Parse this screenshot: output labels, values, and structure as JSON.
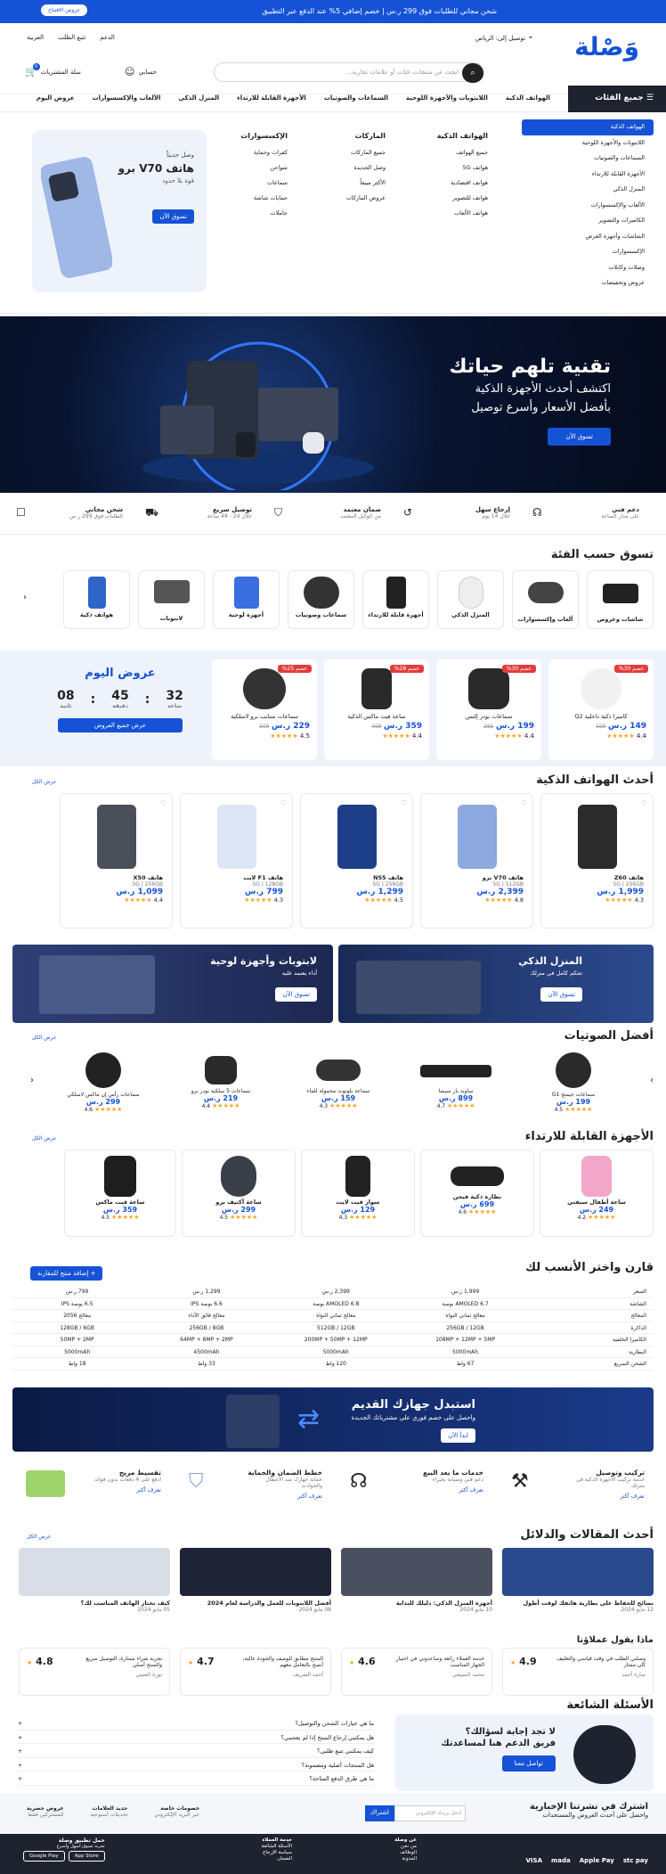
{
  "topbar": {
    "promo": "شحن مجاني للطلبات فوق 299 ر.س  |  خصم إضافي 5% عند الدفع عبر التطبيق",
    "app_button": "عروض الافتتاح"
  },
  "header": {
    "logo": "وَصْلة",
    "deliver": "توصيل إلى: الرياض",
    "links": [
      "الدعم",
      "تتبع الطلب",
      "العربية"
    ],
    "search_placeholder": "ابحث عن منتجات، فئات أو علامات تجارية...",
    "account": "حسابي",
    "cart": "سلة المشتريات",
    "cart_count": "0"
  },
  "nav": {
    "all_categories": "جميع الفئات",
    "links": [
      "الهواتف الذكية",
      "اللابتوبات والأجهزة اللوحية",
      "السماعات والصوتيات",
      "الأجهزة القابلة للارتداء",
      "المنزل الذكي",
      "الألعاب والإكسسوارات",
      "عروض اليوم"
    ]
  },
  "mega": {
    "categories": [
      "الهواتف الذكية",
      "اللابتوبات والأجهزة اللوحية",
      "السماعات والصوتيات",
      "الأجهزة القابلة للارتداء",
      "المنزل الذكي",
      "الألعاب والإكسسوارات",
      "الكاميرات والتصوير",
      "الشاشات وأجهزة العرض",
      "الإكسسوارات",
      "وصلات وكابلات",
      "عروض وتخفيضات"
    ],
    "columns": [
      {
        "title": "الهواتف الذكية",
        "items": [
          "جميع الهواتف",
          "هواتف 5G",
          "هواتف اقتصادية",
          "هواتف للتصوير",
          "هواتف الألعاب"
        ]
      },
      {
        "title": "الماركات",
        "items": [
          "جميع الماركات",
          "وصل الجديدة",
          "الأكثر مبيعاً",
          "عروض الماركات"
        ]
      },
      {
        "title": "الإكسسوارات",
        "items": [
          "كفرات وحماية",
          "شواحن",
          "سماعات",
          "حمايات شاشة",
          "حاملات"
        ]
      }
    ],
    "promo": {
      "kicker": "وصل حديثاً",
      "title": "هاتف V70 برو",
      "subtitle": "قوة بلا حدود",
      "button": "تسوق الآن"
    }
  },
  "hero": {
    "title": "تقنية تلهم حياتك",
    "line1": "اكتشف أحدث الأجهزة الذكية",
    "line2": "بأفضل الأسعار وأسرع توصيل",
    "button": "تسوق الآن"
  },
  "features": [
    {
      "title": "دعم فني",
      "sub": "على مدار الساعة",
      "icon": "headset-icon"
    },
    {
      "title": "إرجاع سهل",
      "sub": "خلال 14 يوم",
      "icon": "return-icon"
    },
    {
      "title": "ضمان معتمد",
      "sub": "من الوكيل المعتمد",
      "icon": "shield-icon"
    },
    {
      "title": "توصيل سريع",
      "sub": "خلال 24 - 48 ساعة",
      "icon": "truck-icon"
    },
    {
      "title": "شحن مجاني",
      "sub": "للطلبات فوق 299 ر.س",
      "icon": "box-icon"
    }
  ],
  "categories": {
    "title": "تسوق حسب الفئة",
    "items": [
      "شاشات وعروض",
      "ألعاب وإكسسوارات",
      "المنزل الذكي",
      "أجهزة قابلة للارتداء",
      "سماعات وصوتيات",
      "أجهزة لوحية",
      "لابتوبات",
      "هواتف ذكية"
    ]
  },
  "deals": {
    "title": "عروض اليوم",
    "hours": "32",
    "minutes": "45",
    "seconds": "08",
    "unit_h": "ساعة",
    "unit_m": "دقيقة",
    "unit_s": "ثانية",
    "button": "عرض جميع العروض",
    "items": [
      {
        "badge": "خصم 30%",
        "name": "كاميرا ذكية داخلية Q2",
        "price": "149 ر.س",
        "old": "199",
        "rating": "4.4"
      },
      {
        "badge": "خصم 30%",
        "name": "سماعات بودز إلتس",
        "price": "199 ر.س",
        "old": "285",
        "rating": "4.4"
      },
      {
        "badge": "خصم 28%",
        "name": "ساعة فيت ماكس الذكية",
        "price": "359 ر.س",
        "old": "499",
        "rating": "4.4"
      },
      {
        "badge": "خصم 25%",
        "name": "سماعات ستايب برو لاسلكية",
        "price": "229 ر.س",
        "old": "309",
        "rating": "4.5"
      }
    ]
  },
  "phones": {
    "title": "أحدث الهواتف الذكية",
    "view_all": "عرض الكل",
    "items": [
      {
        "name": "هاتف Z60",
        "spec": "5G | 256GB",
        "price": "1,999 ر.س",
        "rating": "4.3"
      },
      {
        "name": "هاتف V70 برو",
        "spec": "5G | 512GB",
        "price": "2,399 ر.س",
        "rating": "4.8"
      },
      {
        "name": "هاتف N55",
        "spec": "5G | 256GB",
        "price": "1,299 ر.س",
        "rating": "4.5"
      },
      {
        "name": "هاتف F1 لايت",
        "spec": "5G | 128GB",
        "price": "799 ر.س",
        "rating": "4.3"
      },
      {
        "name": "هاتف X50",
        "spec": "5G | 256GB",
        "price": "1,099 ر.س",
        "rating": "4.4"
      }
    ]
  },
  "banners": [
    {
      "title": "المنزل الذكي",
      "sub": "تحكم كامل في منزلك",
      "button": "تسوق الآن"
    },
    {
      "title": "لابتوبات وأجهزة لوحية",
      "sub": "أداء يعتمد عليه",
      "button": "تسوق الآن"
    }
  ],
  "audio": {
    "title": "أفضل الصوتيات",
    "view_all": "عرض الكل",
    "items": [
      {
        "name": "سماعات جيمنج G1",
        "price": "199 ر.س",
        "rating": "4.5"
      },
      {
        "name": "ساوند بار سينما",
        "price": "899 ر.س",
        "rating": "4.7"
      },
      {
        "name": "سماعة بلوتوث محمولة للماء",
        "price": "159 ر.س",
        "rating": "4.3"
      },
      {
        "name": "سماعات 5 سلكية بودز برو",
        "price": "219 ر.س",
        "rating": "4.4"
      },
      {
        "name": "سماعات رأس إن ماكس لاسلكي",
        "price": "299 ر.س",
        "rating": "4.6"
      }
    ]
  },
  "wearables": {
    "title": "الأجهزة القابلة للارتداء",
    "view_all": "عرض الكل",
    "items": [
      {
        "name": "ساعة أطفال سيفتي",
        "price": "249 ر.س",
        "rating": "4.2"
      },
      {
        "name": "نظارة ذكية فيجن",
        "price": "699 ر.س",
        "rating": "4.6"
      },
      {
        "name": "سوار فيت لايت",
        "price": "129 ر.س",
        "rating": "4.3"
      },
      {
        "name": "ساعة أكتيف برو",
        "price": "299 ر.س",
        "rating": "4.5"
      },
      {
        "name": "ساعة فيت ماكس",
        "price": "359 ر.س",
        "rating": "4.5"
      }
    ]
  },
  "compare": {
    "title": "قارن واختر الأنسب لك",
    "add_button": "+ إضافة منتج للمقارنة",
    "rows": [
      {
        "k": "السعر",
        "v": [
          "1,999 ر.س",
          "2,399 ر.س",
          "1,299 ر.س",
          "799 ر.س"
        ]
      },
      {
        "k": "الشاشة",
        "v": [
          "AMOLED 6.7 بوصة",
          "AMOLED 6.8 بوصة",
          "6.6 بوصة IPS",
          "6.5 بوصة IPS"
        ]
      },
      {
        "k": "المعالج",
        "v": [
          "معالج ثماني النواة",
          "معالج ثماني النواة",
          "معالج فائق الأداء",
          "معالج 2056"
        ]
      },
      {
        "k": "الذاكرة",
        "v": [
          "256GB / 12GB",
          "512GB / 12GB",
          "256GB / 8GB",
          "128GB / 6GB"
        ]
      },
      {
        "k": "الكاميرا الخلفية",
        "v": [
          "108MP + 12MP + 5MP",
          "200MP + 50MP + 12MP",
          "64MP + 8MP + 2MP",
          "50MP + 2MP"
        ]
      },
      {
        "k": "البطارية",
        "v": [
          "5000mAh",
          "5000mAh",
          "4500mAh",
          "5000mAh"
        ]
      },
      {
        "k": "الشحن السريع",
        "v": [
          "67 واط",
          "120 واط",
          "33 واط",
          "18 واط"
        ]
      }
    ]
  },
  "trade": {
    "title": "استبدل جهازك القديم",
    "sub": "واحصل على خصم فوري على مشترياتك الجديدة",
    "button": "ابدأ الآن"
  },
  "services": [
    {
      "title": "تركيب وتوصيل",
      "sub": "خدمة تركيب الأجهزة الذكية في منزلك",
      "link": "تعرف أكثر"
    },
    {
      "title": "خدمات ما بعد البيع",
      "sub": "دعم فني وصيانة بخبراء",
      "link": "تعرف أكثر"
    },
    {
      "title": "خطط الضمان والحماية",
      "sub": "حماية جهازك ضد الأعطال والحوادث",
      "link": "تعرف أكثر"
    },
    {
      "title": "تقسيط مريح",
      "sub": "ادفع على 4 دفعات بدون فوائد",
      "link": "تعرف أكثر"
    }
  ],
  "articles": {
    "title": "أحدث المقالات والدلائل",
    "view_all": "عرض الكل",
    "items": [
      {
        "title": "نصائح للحفاظ على بطارية هاتفك لوقت أطول",
        "date": "12 مايو 2024"
      },
      {
        "title": "أجهزة المنزل الذكي: دليلك للبداية",
        "date": "10 مايو 2024"
      },
      {
        "title": "أفضل اللابتوبات للعمل والدراسة لعام 2024",
        "date": "08 مايو 2024"
      },
      {
        "title": "كيف تختار الهاتف المناسب لك؟",
        "date": "05 مايو 2024"
      }
    ]
  },
  "reviews": {
    "title": "ماذا يقول عملاؤنا",
    "items": [
      {
        "rating": "4.9",
        "text": "وصلني الطلب في وقت قياسي والتغليف كان ممتاز",
        "name": "سارة أحمد"
      },
      {
        "rating": "4.6",
        "text": "خدمة العملاء رائعة وساعدوني في اختيار الجهاز المناسب",
        "name": "محمد السبيعي"
      },
      {
        "rating": "4.7",
        "text": "المنتج مطابق للوصف والجودة عالية، أنصح بالتعامل معهم",
        "name": "أحمد الشريف"
      },
      {
        "rating": "4.8",
        "text": "تجربة شراء ممتازة، التوصيل سريع والمنتج أصلي",
        "name": "نورة العتيبي"
      }
    ]
  },
  "faq": {
    "title": "الأسئلة الشائعة",
    "help_title": "لا تجد إجابة لسؤالك؟",
    "help_sub": "فريق الدعم هنا لمساعدتك",
    "help_button": "تواصل معنا",
    "questions": [
      "ما هي خيارات الشحن والتوصيل؟",
      "هل يمكنني إرجاع المنتج إذا لم يعجبني؟",
      "كيف يمكنني تتبع طلبي؟",
      "هل المنتجات أصلية ومضمونة؟",
      "ما هي طرق الدفع المتاحة؟"
    ]
  },
  "newsletter": {
    "title": "اشترك في نشرتنا الإخبارية",
    "sub": "واحصل على أحدث العروض والمستجدات",
    "placeholder": "أدخل بريدك الإلكتروني",
    "button": "اشتراك",
    "perks": [
      {
        "t": "خصومات خاصة",
        "s": "عبر البريد الإلكتروني"
      },
      {
        "t": "جديد العلامات",
        "s": "تحديثات أسبوعية"
      },
      {
        "t": "عروض حصرية",
        "s": "للمشتركين فقط"
      }
    ]
  },
  "footer": {
    "cols": [
      {
        "t": "عن وصلة",
        "items": [
          "من نحن",
          "الوظائف",
          "المدونة"
        ]
      },
      {
        "t": "خدمة العملاء",
        "items": [
          "الأسئلة الشائعة",
          "سياسة الإرجاع",
          "الضمان"
        ]
      }
    ],
    "app_title": "حمل تطبيق وصلة",
    "app_sub": "تجربة تسوق أسهل وأسرع",
    "stores": [
      "App Store",
      "Google Play"
    ],
    "payments": [
      "VISA",
      "mada",
      "Apple Pay",
      "stc pay"
    ]
  }
}
